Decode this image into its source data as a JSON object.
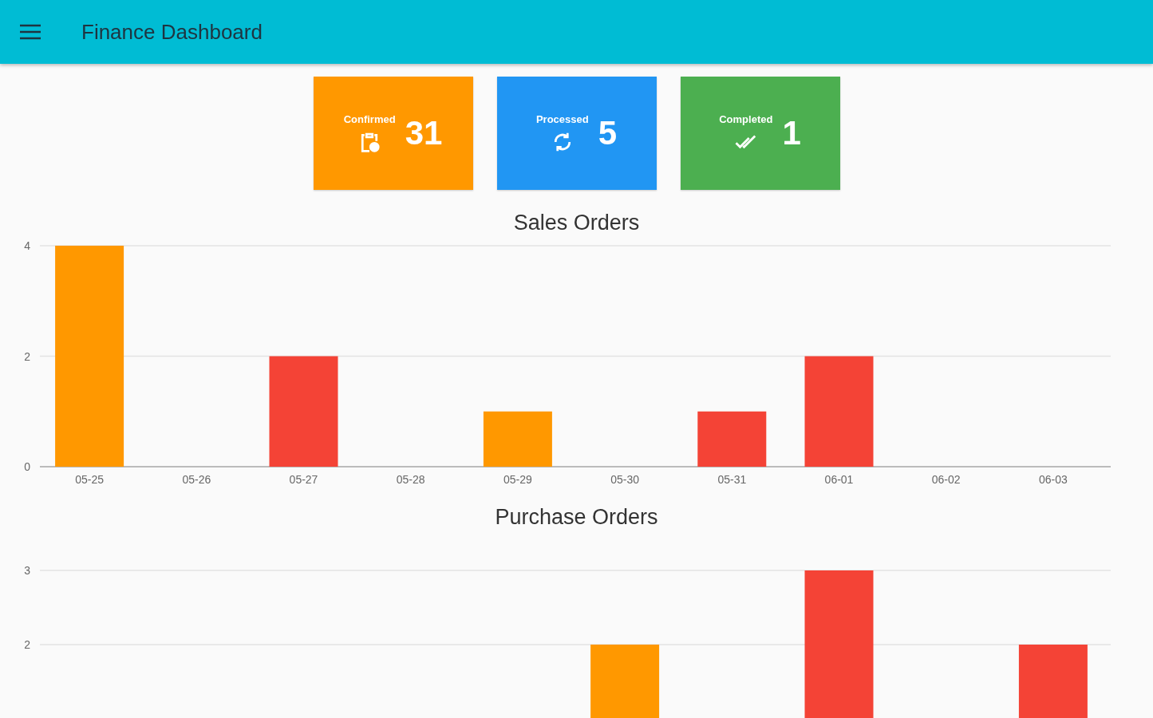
{
  "app_bar": {
    "title": "Finance Dashboard"
  },
  "stat_cards": [
    {
      "kind": "confirmed",
      "label": "Confirmed",
      "count": "31",
      "color": "#ff9800"
    },
    {
      "kind": "processed",
      "label": "Processed",
      "count": "5",
      "color": "#2196f3"
    },
    {
      "kind": "completed",
      "label": "Completed",
      "count": "1",
      "color": "#4caf50"
    }
  ],
  "charts": [
    {
      "chart_data": {
        "type": "bar",
        "title": "Sales Orders",
        "categories": [
          "05-25",
          "05-26",
          "05-27",
          "05-28",
          "05-29",
          "05-30",
          "05-31",
          "06-01",
          "06-02",
          "06-03"
        ],
        "ylim": [
          0,
          4
        ],
        "yticks": [
          0,
          2,
          4
        ],
        "series": [
          {
            "color": "#ff9800",
            "values": [
              4,
              null,
              null,
              null,
              1,
              null,
              null,
              null,
              null,
              null
            ]
          },
          {
            "color": "#f44336",
            "values": [
              null,
              null,
              2,
              null,
              null,
              null,
              1,
              2,
              null,
              null
            ]
          }
        ]
      }
    },
    {
      "chart_data": {
        "type": "bar",
        "title": "Purchase Orders",
        "ylim": [
          0,
          3
        ],
        "yticks": [
          2,
          3
        ],
        "series": [
          {
            "color": "#ff9800",
            "values": [
              null,
              null,
              null,
              null,
              null,
              2,
              null,
              null,
              null,
              null
            ]
          },
          {
            "color": "#f44336",
            "values": [
              null,
              null,
              null,
              null,
              null,
              null,
              null,
              3,
              null,
              2
            ]
          }
        ]
      }
    }
  ]
}
